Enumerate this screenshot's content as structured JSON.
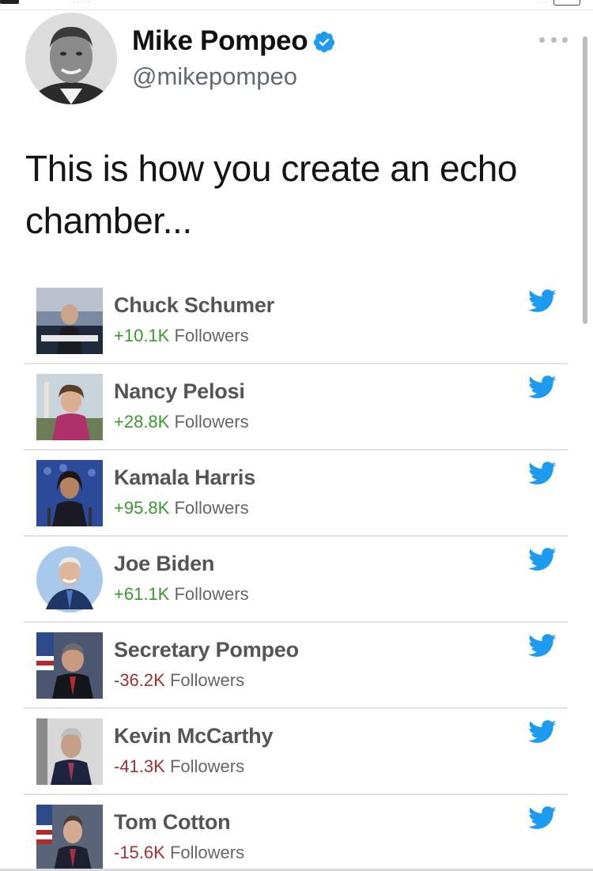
{
  "tweet": {
    "author": {
      "display_name": "Mike Pompeo",
      "handle": "@mikepompeo",
      "verified": true
    },
    "text": "This is how you create an echo chamber..."
  },
  "embedded_list": {
    "followers_label": "Followers",
    "accent_bird_color": "#1d9bf0",
    "up_color": "#3a9a2c",
    "down_color": "#a13232",
    "rows": [
      {
        "name": "Chuck Schumer",
        "change": "+10.1K",
        "direction": "up"
      },
      {
        "name": "Nancy Pelosi",
        "change": "+28.8K",
        "direction": "up"
      },
      {
        "name": "Kamala Harris",
        "change": "+95.8K",
        "direction": "up"
      },
      {
        "name": "Joe Biden",
        "change": "+61.1K",
        "direction": "up"
      },
      {
        "name": "Secretary Pompeo",
        "change": "-36.2K",
        "direction": "down"
      },
      {
        "name": "Kevin McCarthy",
        "change": "-41.3K",
        "direction": "down"
      },
      {
        "name": "Tom Cotton",
        "change": "-15.6K",
        "direction": "down"
      }
    ]
  },
  "icons": {
    "verified": "verified-badge-icon",
    "more": "more-options-icon",
    "twitter": "twitter-bird-icon"
  }
}
